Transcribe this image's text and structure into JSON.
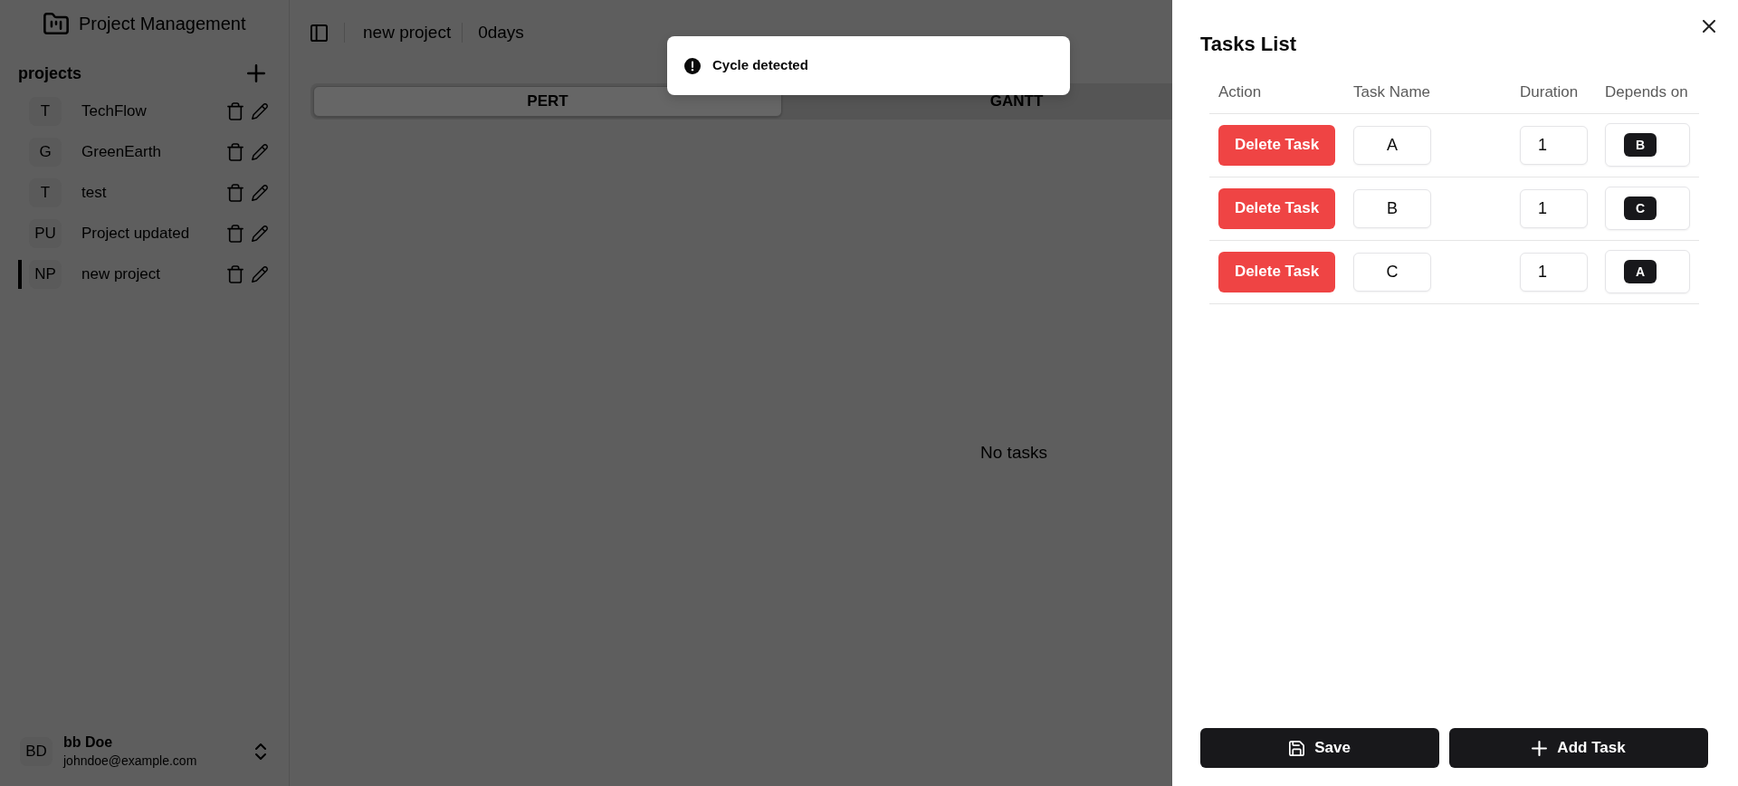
{
  "sidebar": {
    "app_title": "Project Management",
    "section_label": "projects",
    "projects": [
      {
        "initials": "T",
        "name": "TechFlow",
        "selected": false
      },
      {
        "initials": "G",
        "name": "GreenEarth",
        "selected": false
      },
      {
        "initials": "T",
        "name": "test",
        "selected": false
      },
      {
        "initials": "PU",
        "name": "Project updated",
        "selected": false
      },
      {
        "initials": "NP",
        "name": "new project",
        "selected": true
      }
    ],
    "user": {
      "initials": "BD",
      "name": "bb Doe",
      "email": "johndoe@example.com"
    }
  },
  "header": {
    "project_name": "new project",
    "duration": "0days"
  },
  "tabs": [
    {
      "label": "PERT",
      "selected": true
    },
    {
      "label": "GANTT",
      "selected": false
    }
  ],
  "empty_message": "No tasks",
  "toast": {
    "message": "Cycle detected"
  },
  "tasks_panel": {
    "title": "Tasks List",
    "columns": [
      "Action",
      "Task Name",
      "Duration",
      "Depends on"
    ],
    "rows": [
      {
        "action": "Delete Task",
        "task_name": "A",
        "duration": "1",
        "depends_on": [
          "B"
        ]
      },
      {
        "action": "Delete Task",
        "task_name": "B",
        "duration": "1",
        "depends_on": [
          "C"
        ]
      },
      {
        "action": "Delete Task",
        "task_name": "C",
        "duration": "1",
        "depends_on": [
          "A"
        ]
      }
    ],
    "buttons": [
      {
        "kind": "save",
        "label": "Save"
      },
      {
        "kind": "add",
        "label": "Add Task"
      }
    ]
  }
}
